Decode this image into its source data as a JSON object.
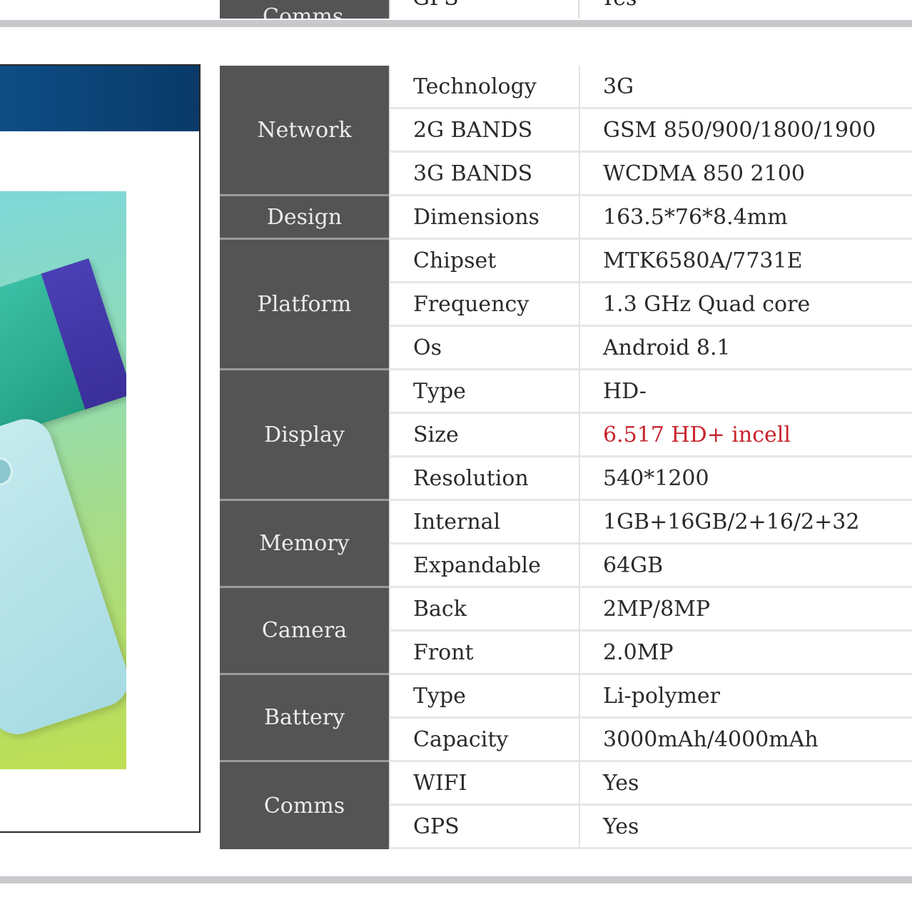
{
  "top_strip": {
    "category": "Comms",
    "key": "GPS",
    "value": "Yes"
  },
  "spec_groups": [
    {
      "category": "Network",
      "rows": [
        {
          "key": "Technology",
          "value": "3G"
        },
        {
          "key": "2G BANDS",
          "value": "GSM 850/900/1800/1900"
        },
        {
          "key": "3G BANDS",
          "value": "WCDMA 850 2100"
        }
      ]
    },
    {
      "category": "Design",
      "rows": [
        {
          "key": "Dimensions",
          "value": "163.5*76*8.4mm"
        }
      ]
    },
    {
      "category": "Platform",
      "rows": [
        {
          "key": "Chipset",
          "value": "MTK6580A/7731E"
        },
        {
          "key": "Frequency",
          "value": "1.3 GHz Quad core"
        },
        {
          "key": "Os",
          "value": "Android 8.1"
        }
      ]
    },
    {
      "category": "Display",
      "rows": [
        {
          "key": "Type",
          "value": "HD-"
        },
        {
          "key": "Size",
          "value": "6.517 HD+ incell"
        },
        {
          "key": "Resolution",
          "value": "540*1200"
        }
      ]
    },
    {
      "category": "Memory",
      "rows": [
        {
          "key": "Internal",
          "value": "1GB+16GB/2+16/2+32"
        },
        {
          "key": "Expandable",
          "value": "64GB"
        }
      ]
    },
    {
      "category": "Camera",
      "rows": [
        {
          "key": "Back",
          "value": "2MP/8MP"
        },
        {
          "key": "Front",
          "value": "2.0MP"
        }
      ]
    },
    {
      "category": "Battery",
      "rows": [
        {
          "key": "Type",
          "value": "Li-polymer"
        },
        {
          "key": "Capacity",
          "value": "3000mAh/4000mAh"
        }
      ]
    },
    {
      "category": "Comms",
      "rows": [
        {
          "key": "WIFI",
          "value": "Yes"
        },
        {
          "key": "GPS",
          "value": "Yes"
        }
      ]
    }
  ],
  "colors": {
    "category_bg": "#545454",
    "highlight_red": "#c8232c",
    "header_blue": "#0d4d85",
    "divider_gray": "#c7c9cd"
  }
}
